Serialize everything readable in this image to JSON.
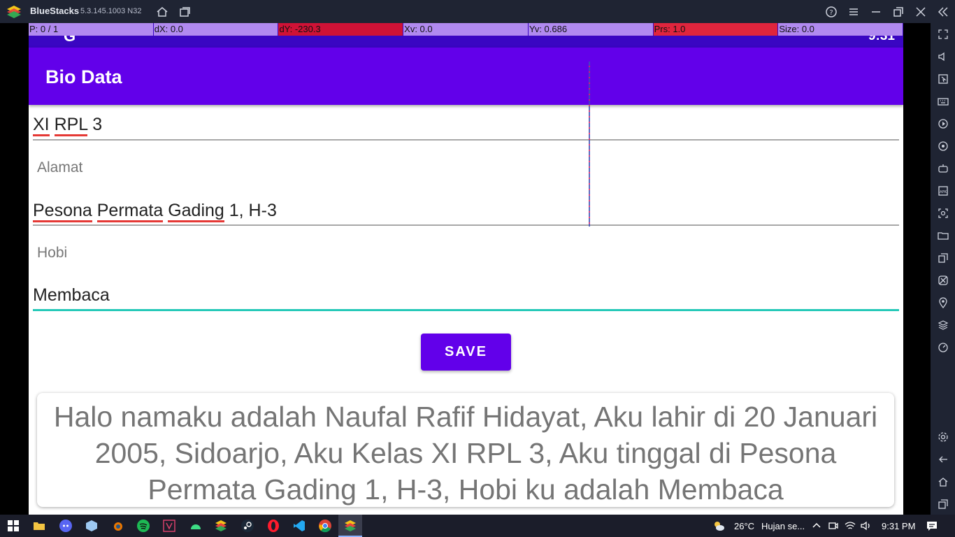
{
  "window": {
    "app_name": "BlueStacks",
    "version": "5.3.145.1003  N32"
  },
  "pointer_overlay": {
    "p": "P: 0 / 1",
    "dx": "dX: 0.0",
    "dy": "dY: -230.3",
    "xv": "Xv: 0.0",
    "yv": "Yv: 0.686",
    "prs": "Prs: 1.0",
    "size": "Size: 0.0"
  },
  "status_bar": {
    "time": "9:31",
    "google_glyph": "G"
  },
  "app_bar": {
    "title": "Bio Data"
  },
  "form": {
    "kelas_value_words": [
      "XI",
      "RPL",
      "3"
    ],
    "alamat_label": "Alamat",
    "alamat_value_words": [
      "Pesona",
      "Permata",
      "Gading",
      "1, H-3"
    ],
    "hobi_label": "Hobi",
    "hobi_value": "Membaca",
    "save_label": "SAVE"
  },
  "result_card": {
    "text": "Halo namaku adalah Naufal Rafif Hidayat, Aku lahir di 20 Januari 2005, Sidoarjo, Aku Kelas XI RPL 3, Aku tinggal di Pesona Permata Gading 1, H-3, Hobi ku adalah Membaca"
  },
  "taskbar": {
    "weather_temp": "26°C",
    "weather_text": "Hujan se...",
    "clock": "9:31 PM"
  },
  "colors": {
    "app_bar": "#6200ea",
    "status_bar": "#3a06c2",
    "focus_underline": "#26c9b8",
    "spell_underline": "#e53935"
  }
}
